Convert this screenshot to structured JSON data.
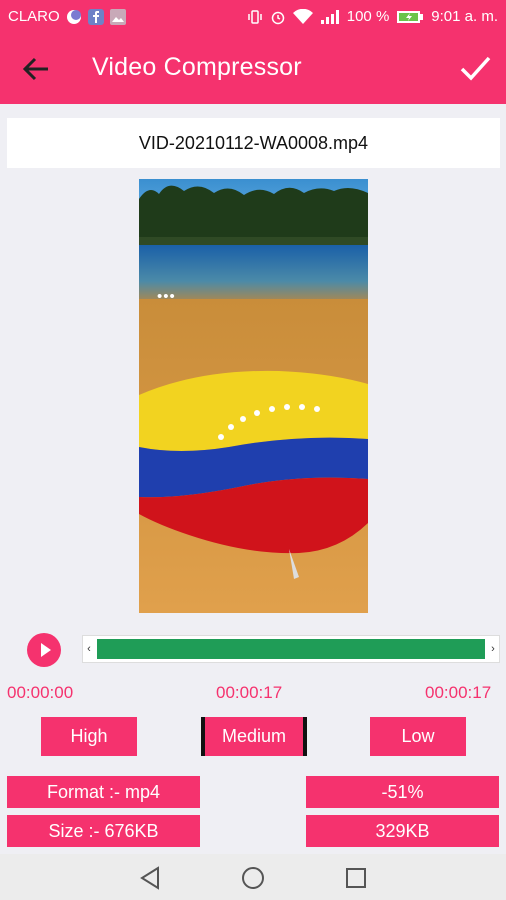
{
  "status_bar": {
    "carrier": "CLARO",
    "battery": "100 %",
    "time": "9:01 a. m."
  },
  "app_bar": {
    "title": "Video Compressor"
  },
  "file": {
    "name": "VID-20210112-WA0008.mp4"
  },
  "video": {
    "overlay_dots": "•••"
  },
  "trim": {
    "start_time": "00:00:00",
    "mid_time": "00:00:17",
    "end_time": "00:00:17",
    "left_handle": "‹",
    "right_handle": "›",
    "selected_fraction": 1.0
  },
  "quality": {
    "options": [
      "High",
      "Medium",
      "Low"
    ],
    "selected": "Medium"
  },
  "info": {
    "format": "Format :- mp4",
    "reduction": "-51%",
    "size": "Size :- 676KB",
    "output_size": "329KB"
  },
  "colors": {
    "accent": "#f5326e",
    "progress": "#1f9d57"
  }
}
